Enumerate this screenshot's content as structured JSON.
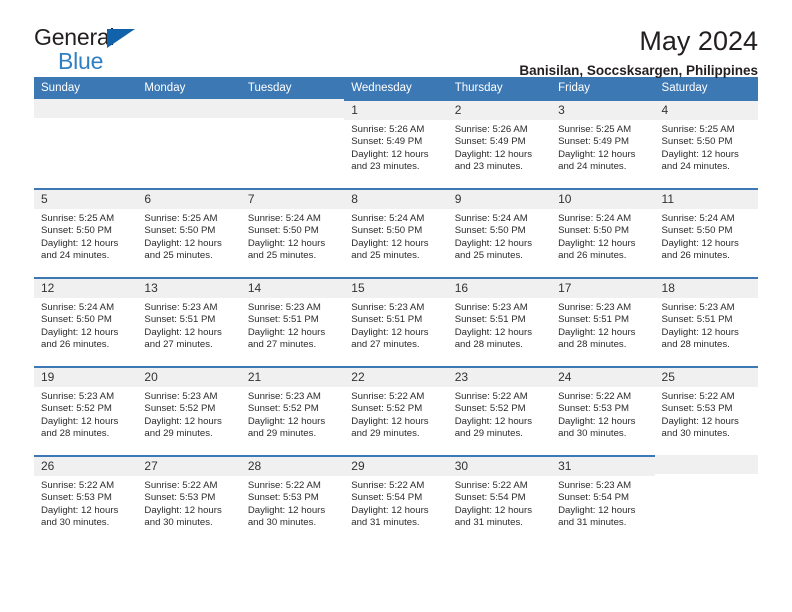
{
  "brand": {
    "name_top": "General",
    "name_bottom": "Blue",
    "accent_color": "#2f7fc4",
    "triangle_color": "#1161ab"
  },
  "header": {
    "title": "May 2024",
    "subtitle": "Banisilan, Soccsksargen, Philippines"
  },
  "calendar": {
    "header_bg": "#3c78b4",
    "daynum_bg": "#f0f0f0",
    "weekday_headers": [
      "Sunday",
      "Monday",
      "Tuesday",
      "Wednesday",
      "Thursday",
      "Friday",
      "Saturday"
    ],
    "weeks": [
      [
        {
          "day": "",
          "empty": true
        },
        {
          "day": "",
          "empty": true
        },
        {
          "day": "",
          "empty": true
        },
        {
          "day": "1",
          "sunrise": "Sunrise: 5:26 AM",
          "sunset": "Sunset: 5:49 PM",
          "daylight1": "Daylight: 12 hours",
          "daylight2": "and 23 minutes."
        },
        {
          "day": "2",
          "sunrise": "Sunrise: 5:26 AM",
          "sunset": "Sunset: 5:49 PM",
          "daylight1": "Daylight: 12 hours",
          "daylight2": "and 23 minutes."
        },
        {
          "day": "3",
          "sunrise": "Sunrise: 5:25 AM",
          "sunset": "Sunset: 5:49 PM",
          "daylight1": "Daylight: 12 hours",
          "daylight2": "and 24 minutes."
        },
        {
          "day": "4",
          "sunrise": "Sunrise: 5:25 AM",
          "sunset": "Sunset: 5:50 PM",
          "daylight1": "Daylight: 12 hours",
          "daylight2": "and 24 minutes."
        }
      ],
      [
        {
          "day": "5",
          "sunrise": "Sunrise: 5:25 AM",
          "sunset": "Sunset: 5:50 PM",
          "daylight1": "Daylight: 12 hours",
          "daylight2": "and 24 minutes."
        },
        {
          "day": "6",
          "sunrise": "Sunrise: 5:25 AM",
          "sunset": "Sunset: 5:50 PM",
          "daylight1": "Daylight: 12 hours",
          "daylight2": "and 25 minutes."
        },
        {
          "day": "7",
          "sunrise": "Sunrise: 5:24 AM",
          "sunset": "Sunset: 5:50 PM",
          "daylight1": "Daylight: 12 hours",
          "daylight2": "and 25 minutes."
        },
        {
          "day": "8",
          "sunrise": "Sunrise: 5:24 AM",
          "sunset": "Sunset: 5:50 PM",
          "daylight1": "Daylight: 12 hours",
          "daylight2": "and 25 minutes."
        },
        {
          "day": "9",
          "sunrise": "Sunrise: 5:24 AM",
          "sunset": "Sunset: 5:50 PM",
          "daylight1": "Daylight: 12 hours",
          "daylight2": "and 25 minutes."
        },
        {
          "day": "10",
          "sunrise": "Sunrise: 5:24 AM",
          "sunset": "Sunset: 5:50 PM",
          "daylight1": "Daylight: 12 hours",
          "daylight2": "and 26 minutes."
        },
        {
          "day": "11",
          "sunrise": "Sunrise: 5:24 AM",
          "sunset": "Sunset: 5:50 PM",
          "daylight1": "Daylight: 12 hours",
          "daylight2": "and 26 minutes."
        }
      ],
      [
        {
          "day": "12",
          "sunrise": "Sunrise: 5:24 AM",
          "sunset": "Sunset: 5:50 PM",
          "daylight1": "Daylight: 12 hours",
          "daylight2": "and 26 minutes."
        },
        {
          "day": "13",
          "sunrise": "Sunrise: 5:23 AM",
          "sunset": "Sunset: 5:51 PM",
          "daylight1": "Daylight: 12 hours",
          "daylight2": "and 27 minutes."
        },
        {
          "day": "14",
          "sunrise": "Sunrise: 5:23 AM",
          "sunset": "Sunset: 5:51 PM",
          "daylight1": "Daylight: 12 hours",
          "daylight2": "and 27 minutes."
        },
        {
          "day": "15",
          "sunrise": "Sunrise: 5:23 AM",
          "sunset": "Sunset: 5:51 PM",
          "daylight1": "Daylight: 12 hours",
          "daylight2": "and 27 minutes."
        },
        {
          "day": "16",
          "sunrise": "Sunrise: 5:23 AM",
          "sunset": "Sunset: 5:51 PM",
          "daylight1": "Daylight: 12 hours",
          "daylight2": "and 28 minutes."
        },
        {
          "day": "17",
          "sunrise": "Sunrise: 5:23 AM",
          "sunset": "Sunset: 5:51 PM",
          "daylight1": "Daylight: 12 hours",
          "daylight2": "and 28 minutes."
        },
        {
          "day": "18",
          "sunrise": "Sunrise: 5:23 AM",
          "sunset": "Sunset: 5:51 PM",
          "daylight1": "Daylight: 12 hours",
          "daylight2": "and 28 minutes."
        }
      ],
      [
        {
          "day": "19",
          "sunrise": "Sunrise: 5:23 AM",
          "sunset": "Sunset: 5:52 PM",
          "daylight1": "Daylight: 12 hours",
          "daylight2": "and 28 minutes."
        },
        {
          "day": "20",
          "sunrise": "Sunrise: 5:23 AM",
          "sunset": "Sunset: 5:52 PM",
          "daylight1": "Daylight: 12 hours",
          "daylight2": "and 29 minutes."
        },
        {
          "day": "21",
          "sunrise": "Sunrise: 5:23 AM",
          "sunset": "Sunset: 5:52 PM",
          "daylight1": "Daylight: 12 hours",
          "daylight2": "and 29 minutes."
        },
        {
          "day": "22",
          "sunrise": "Sunrise: 5:22 AM",
          "sunset": "Sunset: 5:52 PM",
          "daylight1": "Daylight: 12 hours",
          "daylight2": "and 29 minutes."
        },
        {
          "day": "23",
          "sunrise": "Sunrise: 5:22 AM",
          "sunset": "Sunset: 5:52 PM",
          "daylight1": "Daylight: 12 hours",
          "daylight2": "and 29 minutes."
        },
        {
          "day": "24",
          "sunrise": "Sunrise: 5:22 AM",
          "sunset": "Sunset: 5:53 PM",
          "daylight1": "Daylight: 12 hours",
          "daylight2": "and 30 minutes."
        },
        {
          "day": "25",
          "sunrise": "Sunrise: 5:22 AM",
          "sunset": "Sunset: 5:53 PM",
          "daylight1": "Daylight: 12 hours",
          "daylight2": "and 30 minutes."
        }
      ],
      [
        {
          "day": "26",
          "sunrise": "Sunrise: 5:22 AM",
          "sunset": "Sunset: 5:53 PM",
          "daylight1": "Daylight: 12 hours",
          "daylight2": "and 30 minutes."
        },
        {
          "day": "27",
          "sunrise": "Sunrise: 5:22 AM",
          "sunset": "Sunset: 5:53 PM",
          "daylight1": "Daylight: 12 hours",
          "daylight2": "and 30 minutes."
        },
        {
          "day": "28",
          "sunrise": "Sunrise: 5:22 AM",
          "sunset": "Sunset: 5:53 PM",
          "daylight1": "Daylight: 12 hours",
          "daylight2": "and 30 minutes."
        },
        {
          "day": "29",
          "sunrise": "Sunrise: 5:22 AM",
          "sunset": "Sunset: 5:54 PM",
          "daylight1": "Daylight: 12 hours",
          "daylight2": "and 31 minutes."
        },
        {
          "day": "30",
          "sunrise": "Sunrise: 5:22 AM",
          "sunset": "Sunset: 5:54 PM",
          "daylight1": "Daylight: 12 hours",
          "daylight2": "and 31 minutes."
        },
        {
          "day": "31",
          "sunrise": "Sunrise: 5:23 AM",
          "sunset": "Sunset: 5:54 PM",
          "daylight1": "Daylight: 12 hours",
          "daylight2": "and 31 minutes."
        },
        {
          "day": "",
          "empty": true
        }
      ]
    ]
  }
}
